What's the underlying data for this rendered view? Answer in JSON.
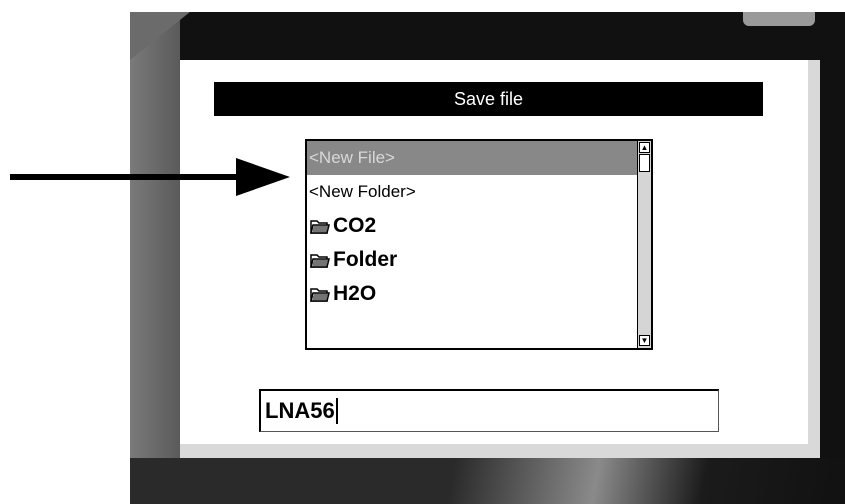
{
  "dialog": {
    "title": "Save file"
  },
  "file_list": {
    "items": [
      {
        "label": "<New File>",
        "type": "action",
        "selected": true
      },
      {
        "label": "<New Folder>",
        "type": "action",
        "selected": false
      },
      {
        "label": "CO2",
        "type": "folder",
        "icon": "folder-icon",
        "selected": false
      },
      {
        "label": "Folder",
        "type": "folder",
        "icon": "folder-icon",
        "selected": false
      },
      {
        "label": "H2O",
        "type": "folder",
        "icon": "folder-icon",
        "selected": false
      }
    ]
  },
  "filename_input": {
    "value": "LNA56"
  },
  "colors": {
    "title_bar": "#000000",
    "selection": "#888888",
    "bezel": "#111111"
  }
}
